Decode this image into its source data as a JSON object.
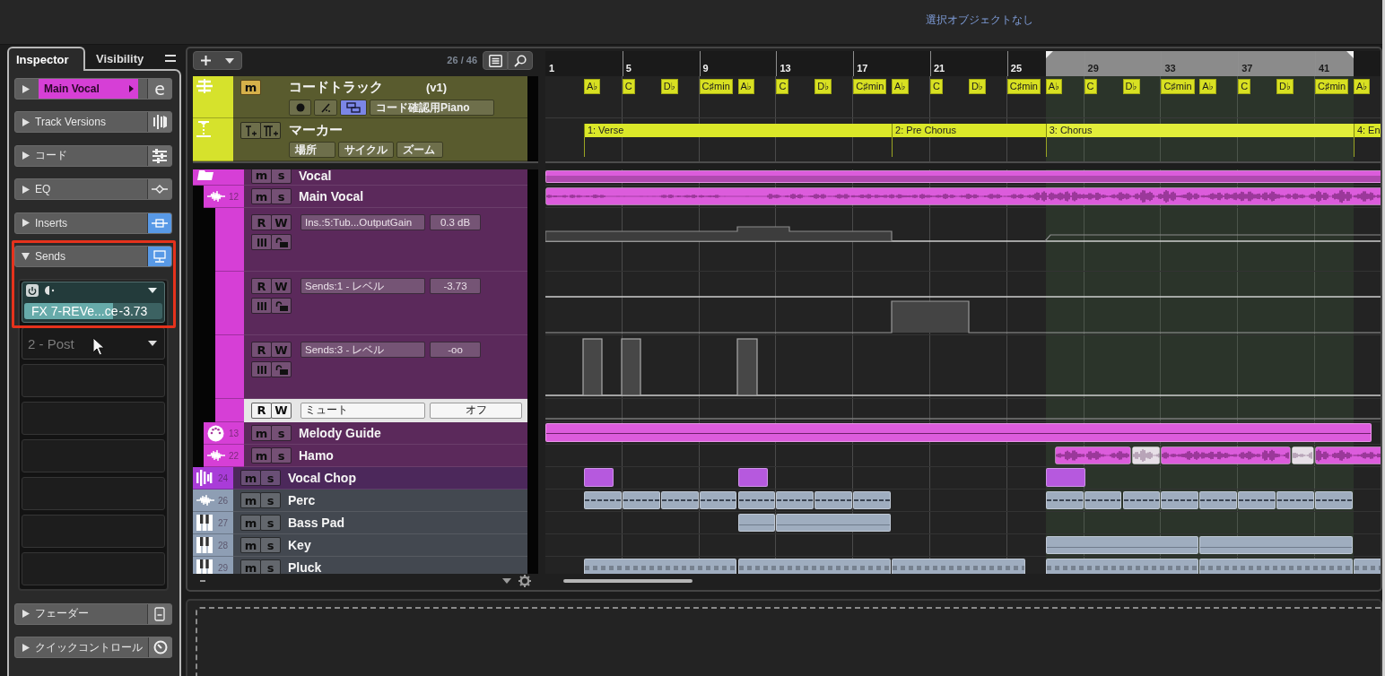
{
  "status_text": "選択オブジェクトなし",
  "inspector": {
    "tabs": [
      {
        "label": "Inspector",
        "selected": true
      },
      {
        "label": "Visibility",
        "selected": false
      }
    ],
    "track": {
      "name": "Main Vocal",
      "color": "#d63fd6",
      "expanded": false,
      "edit_label": "e"
    },
    "sections": [
      {
        "kind": "versions",
        "label": "Track Versions",
        "expanded": false,
        "on": false,
        "highlighted": false
      },
      {
        "kind": "chords",
        "label": "コード",
        "expanded": false,
        "on": false,
        "highlighted": false
      },
      {
        "kind": "eq",
        "label": "EQ",
        "expanded": false,
        "on": false,
        "highlighted": false
      },
      {
        "kind": "inserts",
        "label": "Inserts",
        "expanded": false,
        "on": true,
        "highlighted": false
      },
      {
        "kind": "sends",
        "label": "Sends",
        "expanded": true,
        "on": true,
        "highlighted": true
      },
      {
        "kind": "fader",
        "label": "フェーダー",
        "expanded": false,
        "on": false,
        "highlighted": false
      },
      {
        "kind": "quick",
        "label": "クイックコントロール",
        "expanded": false,
        "on": false,
        "highlighted": false
      }
    ],
    "sends": [
      {
        "kind": "assigned",
        "name": "FX 7-REVe...ce",
        "value": "-3.73",
        "level": 0.64
      },
      {
        "kind": "empty",
        "label": "2 - Post"
      },
      {
        "kind": "blank"
      },
      {
        "kind": "blank"
      },
      {
        "kind": "blank"
      },
      {
        "kind": "blank"
      },
      {
        "kind": "blank"
      },
      {
        "kind": "blank"
      }
    ]
  },
  "project": {
    "toolbar": {
      "track_count": "26 / 46"
    },
    "chord_track": {
      "mute_label": "m",
      "name": "コードトラック",
      "version": "(v1)",
      "toggle_on": true,
      "instrument": "コード確認用Piano"
    },
    "marker_track": {
      "name": "マーカー",
      "buttons": [
        "場所",
        "サイクル",
        "ズーム"
      ]
    },
    "tracks": [
      {
        "kind": "folder",
        "name": "Vocal",
        "color": "#d63fd6",
        "mute_label": "m",
        "solo_label": "s",
        "children": [
          {
            "kind": "audio",
            "number": "12",
            "name": "Main Vocal",
            "color": "#d63fd6",
            "mute_label": "m",
            "solo_label": "s",
            "automation": [
              {
                "kind": "value",
                "read_label": "R",
                "write_label": "W",
                "parameter": "Ins.:5:Tub...OutputGain",
                "value": "0.3 dB",
                "selected": false
              },
              {
                "kind": "value",
                "read_label": "R",
                "write_label": "W",
                "parameter": "Sends:1 - レベル",
                "value": "-3.73",
                "selected": false
              },
              {
                "kind": "value",
                "read_label": "R",
                "write_label": "W",
                "parameter": "Sends:3 - レベル",
                "value": "-oo",
                "selected": false
              },
              {
                "kind": "switch",
                "read_label": "R",
                "write_label": "W",
                "parameter": "ミュート",
                "value": "オフ",
                "selected": true
              }
            ]
          },
          {
            "kind": "midi",
            "number": "13",
            "name": "Melody Guide",
            "color": "#d63fd6",
            "mute_label": "m",
            "solo_label": "s"
          },
          {
            "kind": "audio",
            "number": "22",
            "name": "Hamo",
            "color": "#d63fd6",
            "mute_label": "m",
            "solo_label": "s"
          }
        ]
      },
      {
        "kind": "sampler",
        "number": "24",
        "name": "Vocal Chop",
        "color": "#a93cd8",
        "mute_label": "m",
        "solo_label": "s"
      },
      {
        "kind": "audio",
        "number": "26",
        "name": "Perc",
        "color": "#8e9eb4",
        "mute_label": "m",
        "solo_label": "s"
      },
      {
        "kind": "instrument",
        "number": "27",
        "name": "Bass Pad",
        "color": "#8e9eb4",
        "mute_label": "m",
        "solo_label": "s"
      },
      {
        "kind": "instrument",
        "number": "28",
        "name": "Key",
        "color": "#8e9eb4",
        "mute_label": "m",
        "solo_label": "s"
      },
      {
        "kind": "instrument",
        "number": "29",
        "name": "Pluck",
        "color": "#8e9eb4",
        "mute_label": "m",
        "solo_label": "s"
      }
    ],
    "ruler": {
      "bars": [
        "1",
        "5",
        "9",
        "13",
        "17",
        "21",
        "25",
        "29",
        "33",
        "37",
        "41"
      ]
    },
    "chords": [
      "A♭",
      "C",
      "D♭",
      "C♯min",
      "A♭",
      "C",
      "D♭",
      "C♯min",
      "A♭",
      "C",
      "D♭",
      "C♯min",
      "A♭",
      "C",
      "D♭",
      "C♯min",
      "A♭",
      "C",
      "D♭",
      "C♯min",
      "A♭"
    ],
    "markers": [
      {
        "label": "1: Verse",
        "selected": false
      },
      {
        "label": "2: Pre Chorus",
        "selected": false
      },
      {
        "label": "3: Chorus",
        "selected": true
      },
      {
        "label": "4: En",
        "selected": false
      }
    ]
  }
}
